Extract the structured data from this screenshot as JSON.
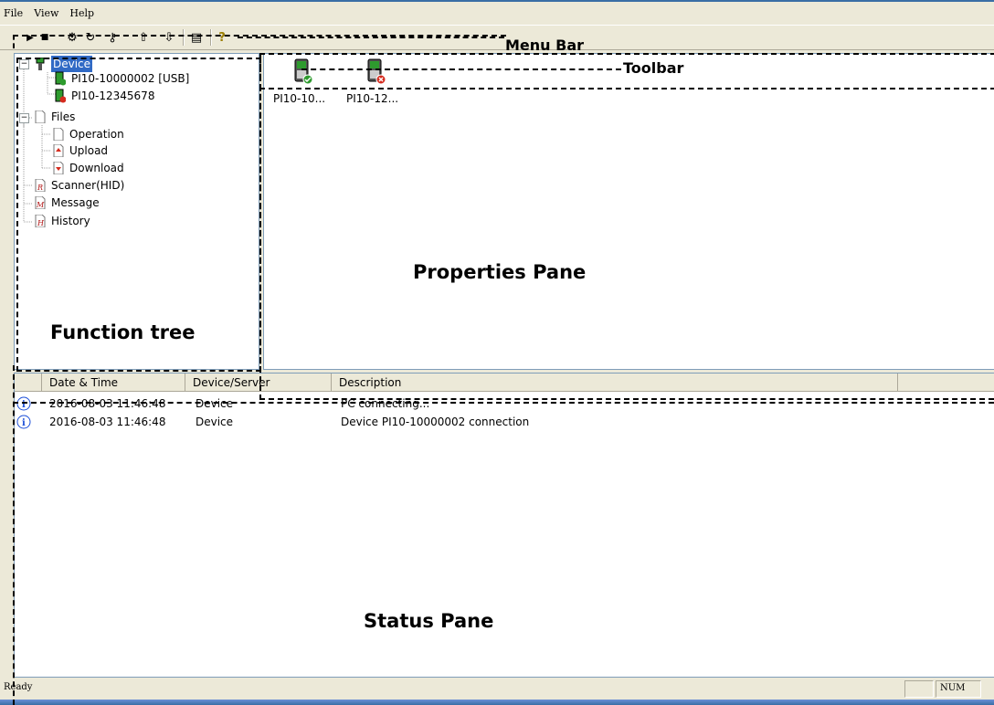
{
  "menu": {
    "file": "File",
    "view": "View",
    "help": "Help"
  },
  "toolbar": {
    "buttons": [
      {
        "name": "play-icon",
        "glyph": "▶"
      },
      {
        "name": "stop-icon",
        "glyph": "■"
      },
      {
        "name": "settings-icon",
        "glyph": "⚙"
      },
      {
        "name": "refresh-icon",
        "glyph": "↻"
      },
      {
        "name": "key-icon",
        "glyph": "⚷"
      },
      {
        "name": "upload-device-icon",
        "glyph": "⇧"
      },
      {
        "name": "download-device-icon",
        "glyph": "⇩"
      },
      {
        "name": "scanner-icon",
        "glyph": "▤"
      },
      {
        "name": "help-icon",
        "glyph": "?"
      }
    ]
  },
  "tree": {
    "device": "Device",
    "device_usb": "PI10-10000002 [USB]",
    "device_other": "PI10-12345678",
    "files": "Files",
    "operation": "Operation",
    "upload": "Upload",
    "download": "Download",
    "scanner": "Scanner(HID)",
    "message": "Message",
    "history": "History"
  },
  "properties": {
    "devices": [
      {
        "label": "PI10-10...",
        "status": "connected"
      },
      {
        "label": "PI10-12...",
        "status": "disconnected"
      }
    ]
  },
  "status": {
    "columns": [
      "Date & Time",
      "Device/Server",
      "Description"
    ],
    "rows": [
      {
        "datetime": "2016-08-03 11:46:48",
        "source": "Device",
        "description": "PC connecting..."
      },
      {
        "datetime": "2016-08-03 11:46:48",
        "source": "Device",
        "description": "Device PI10-10000002 connection"
      }
    ]
  },
  "statusbar": {
    "text": "Ready",
    "num": "NUM"
  },
  "annotations": {
    "menu_bar": "Menu Bar",
    "toolbar": "Toolbar",
    "properties_pane": "Properties Pane",
    "function_tree": "Function tree",
    "status_pane": "Status Pane"
  },
  "colors": {
    "selection": "#316ac5",
    "connected": "#2e9b2e",
    "disconnected": "#d52b1e",
    "info": "#1c4fd8"
  }
}
